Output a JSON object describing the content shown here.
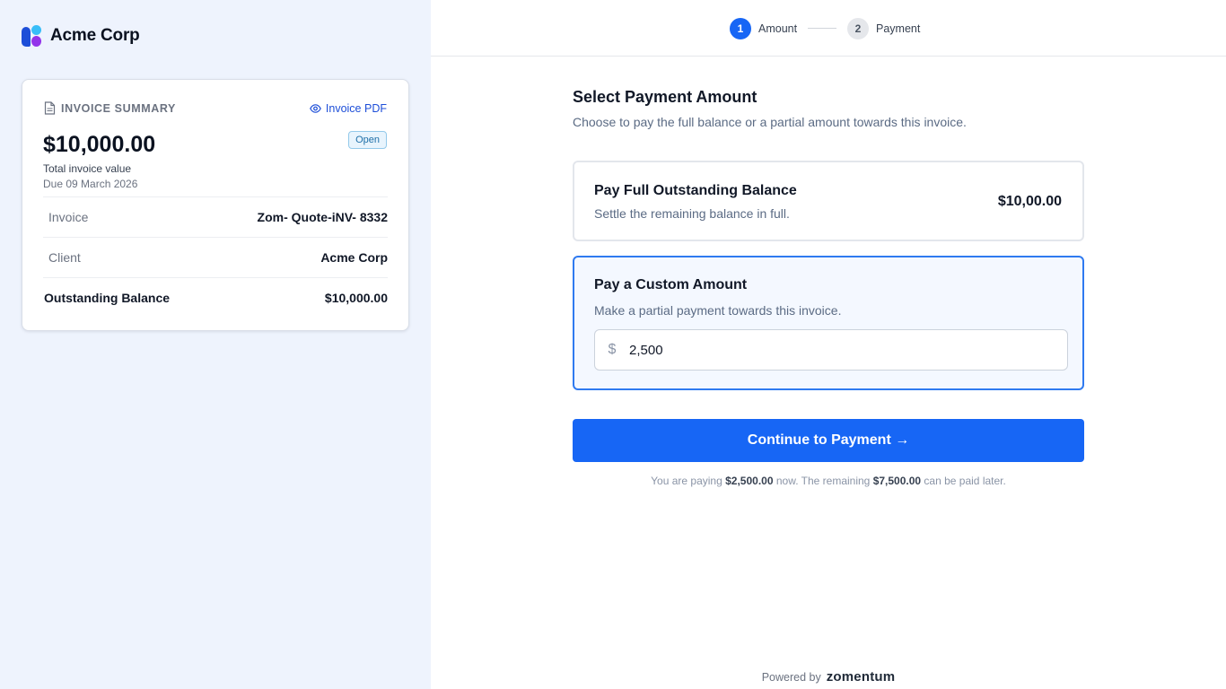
{
  "brand": {
    "name": "Acme Corp"
  },
  "summary": {
    "title": "INVOICE SUMMARY",
    "pdf_label": "Invoice PDF",
    "total": "$10,000.00",
    "status": "Open",
    "total_label": "Total invoice value",
    "due": "Due 09 March 2026",
    "rows": [
      {
        "label": "Invoice",
        "value": "Zom- Quote-iNV- 8332"
      },
      {
        "label": "Client",
        "value": "Acme Corp"
      },
      {
        "label": "Outstanding Balance",
        "value": "$10,000.00"
      }
    ]
  },
  "stepper": {
    "steps": [
      {
        "num": "1",
        "label": "Amount",
        "active": true
      },
      {
        "num": "2",
        "label": "Payment",
        "active": false
      }
    ]
  },
  "main": {
    "title": "Select Payment Amount",
    "description": "Choose to pay the full balance or a partial amount towards this invoice.",
    "full": {
      "title": "Pay Full Outstanding Balance",
      "subtitle": "Settle the remaining balance in full.",
      "amount": "$10,00.00"
    },
    "custom": {
      "title": "Pay a Custom Amount",
      "subtitle": "Make a partial payment towards this invoice.",
      "currency": "$",
      "value": "2,500"
    },
    "cta": "Continue to Payment →",
    "note": {
      "pre": "You are paying ",
      "paying": "$2,500.00",
      "mid": " now. The remaining ",
      "remaining": "$7,500.00",
      "post": " can be paid later."
    }
  },
  "footer": {
    "powered_label": "Powered by",
    "brand": "zomentum"
  },
  "colors": {
    "accent": "#1766f5",
    "selected_border": "#2f7af0",
    "left_bg": "#eef3fd"
  }
}
